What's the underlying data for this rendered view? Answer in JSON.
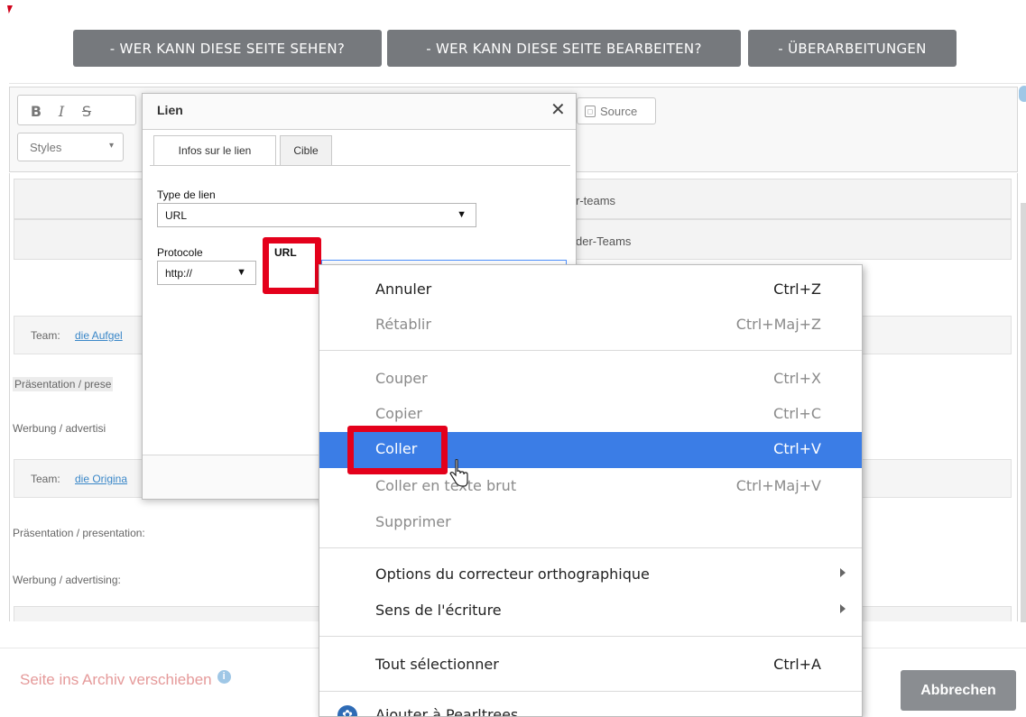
{
  "permissions": {
    "who_can_see": "- WER KANN DIESE SEITE SEHEN?",
    "who_can_edit": "- WER KANN DIESE SEITE BEARBEITEN?",
    "revisions": "- ÜBERARBEITUNGEN"
  },
  "toolbar": {
    "bold": "B",
    "italic": "I",
    "strike": "S",
    "styles_label": "Styles",
    "styles_caret": "▾",
    "source_label": "Source",
    "icons": [
      "bold-icon",
      "italic-icon",
      "strikethrough-icon",
      "source-icon"
    ]
  },
  "content": {
    "row1_partial": "r-teams",
    "row2_partial": "der-Teams",
    "team1_prefix": "Team:",
    "team1_link": "die Aufgel",
    "presentation1": "Präsentation / prese",
    "advertising1": "Werbung / advertisi",
    "team2_prefix": "Team:",
    "team2_link": "die Origina",
    "presentation2": "Präsentation / presentation:",
    "advertising2": "Werbung / advertising:"
  },
  "footer": {
    "archive_label": "Seite ins Archiv verschieben",
    "info_glyph": "i",
    "cancel_label": "Abbrechen"
  },
  "dialog": {
    "title": "Lien",
    "close_glyph": "✕",
    "tabs": [
      {
        "label": "Infos sur le lien",
        "active": true
      },
      {
        "label": "Cible",
        "active": false
      }
    ],
    "link_type_label": "Type de lien",
    "link_type_value": "URL",
    "protocol_label": "Protocole",
    "protocol_value": "http://",
    "url_label": "URL",
    "url_value": "",
    "caret_glyph": "▼"
  },
  "context_menu": {
    "items": [
      {
        "label": "Annuler",
        "shortcut": "Ctrl+Z",
        "state": "enabled"
      },
      {
        "label": "Rétablir",
        "shortcut": "Ctrl+Maj+Z",
        "state": "disabled"
      },
      {
        "label": "Couper",
        "shortcut": "Ctrl+X",
        "state": "disabled"
      },
      {
        "label": "Copier",
        "shortcut": "Ctrl+C",
        "state": "disabled"
      },
      {
        "label": "Coller",
        "shortcut": "Ctrl+V",
        "state": "selected"
      },
      {
        "label": "Coller en texte brut",
        "shortcut": "Ctrl+Maj+V",
        "state": "disabled"
      },
      {
        "label": "Supprimer",
        "shortcut": "",
        "state": "disabled"
      },
      {
        "label": "Options du correcteur orthographique",
        "shortcut": "",
        "state": "enabled",
        "submenu": true
      },
      {
        "label": "Sens de l'écriture",
        "shortcut": "",
        "state": "enabled",
        "submenu": true
      },
      {
        "label": "Tout sélectionner",
        "shortcut": "Ctrl+A",
        "state": "enabled"
      },
      {
        "label": "Ajouter à Pearltrees",
        "shortcut": "",
        "state": "enabled",
        "icon": "pearltrees-icon"
      }
    ]
  },
  "colors": {
    "perm_button_bg": "#76797d",
    "highlight_red": "#e4001b",
    "menu_selected": "#3b7de6",
    "link_blue": "#3a87c8",
    "archive_pink": "#e59a9a"
  }
}
